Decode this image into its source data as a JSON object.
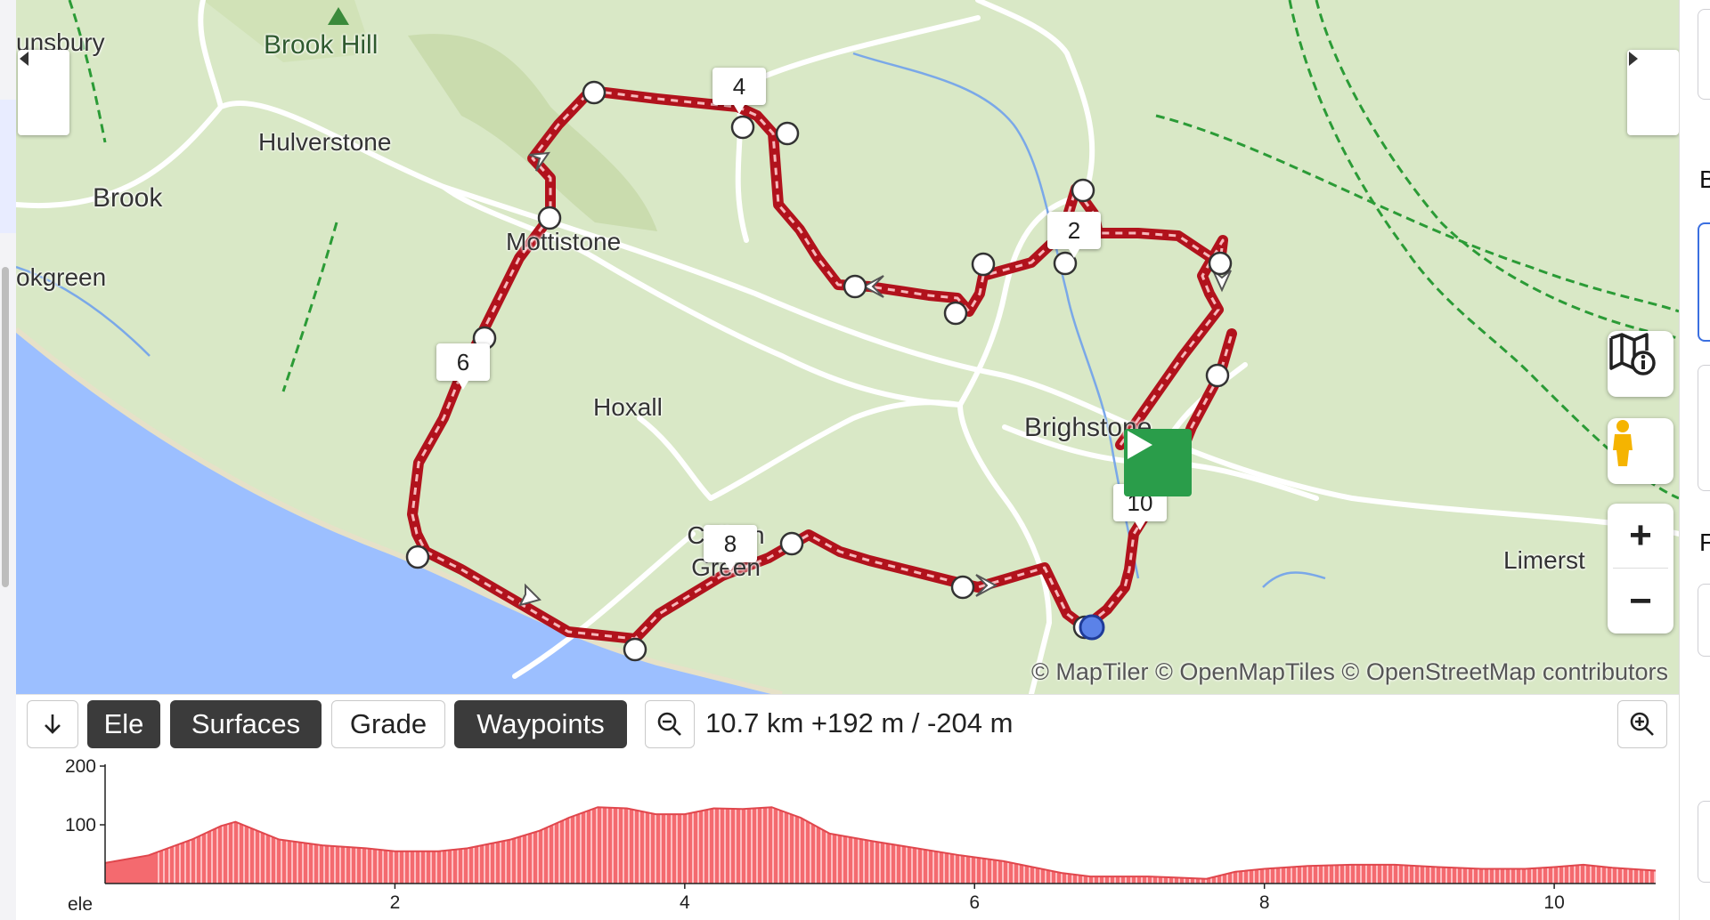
{
  "map": {
    "places": [
      {
        "id": "brook-hill",
        "text": "Brook Hill"
      },
      {
        "id": "shalcombe",
        "text": "unsbury"
      },
      {
        "id": "hulverstone",
        "text": "Hulverstone"
      },
      {
        "id": "brook",
        "text": "Brook"
      },
      {
        "id": "brookgreen",
        "text": "okgreen"
      },
      {
        "id": "mottistone",
        "text": "Mottistone"
      },
      {
        "id": "hoxall",
        "text": "Hoxall"
      },
      {
        "id": "brighstone",
        "text": "Brighstone"
      },
      {
        "id": "chilton-green",
        "text": "Chilton Green"
      },
      {
        "id": "limerstone",
        "text": "Limerst"
      }
    ],
    "km_markers": [
      "2",
      "4",
      "6",
      "8",
      "10"
    ],
    "attribution": "© MapTiler © OpenMapTiles © OpenStreetMap contributors",
    "colors": {
      "route": "#c8232c",
      "land": "#d9e8c6",
      "sea": "#9cbfff",
      "start": "#2a9d4a",
      "cursor": "#5b82e8"
    }
  },
  "controls": {
    "prev_icon": "triangle-left-icon",
    "next_icon": "triangle-right-icon",
    "map_info_icon": "map-info-icon",
    "street_view_icon": "pegman-icon",
    "zoom_in": "+",
    "zoom_out": "−"
  },
  "right_panel": {
    "letters": [
      "B",
      "F"
    ]
  },
  "toolbar": {
    "collapse_icon": "↓",
    "ele": "Ele",
    "surfaces": "Surfaces",
    "grade": "Grade",
    "waypoints": "Waypoints",
    "stats": "10.7 km +192 m / -204 m"
  },
  "chart_data": {
    "type": "area",
    "xlabel": "",
    "ylabel": "ele",
    "xlim": [
      0,
      10.7
    ],
    "ylim": [
      0,
      200
    ],
    "x_ticks": [
      "2",
      "4",
      "6",
      "8",
      "10"
    ],
    "y_ticks": [
      "100",
      "200"
    ],
    "x": [
      0,
      0.3,
      0.6,
      0.8,
      0.9,
      1.0,
      1.2,
      1.5,
      1.8,
      2.0,
      2.3,
      2.5,
      2.8,
      3.0,
      3.2,
      3.4,
      3.6,
      3.8,
      4.0,
      4.2,
      4.4,
      4.6,
      4.8,
      5.0,
      5.3,
      5.6,
      5.9,
      6.2,
      6.4,
      6.6,
      6.8,
      7.0,
      7.2,
      7.4,
      7.6,
      7.8,
      8.0,
      8.3,
      8.6,
      8.9,
      9.2,
      9.5,
      9.8,
      10.0,
      10.2,
      10.4,
      10.7
    ],
    "y": [
      35,
      48,
      75,
      98,
      105,
      95,
      75,
      65,
      60,
      55,
      55,
      60,
      75,
      90,
      112,
      130,
      128,
      118,
      118,
      128,
      127,
      130,
      112,
      85,
      72,
      60,
      48,
      38,
      28,
      18,
      12,
      12,
      12,
      10,
      8,
      20,
      25,
      30,
      32,
      32,
      28,
      25,
      25,
      28,
      32,
      27,
      22
    ],
    "series": [
      {
        "values": []
      }
    ]
  }
}
